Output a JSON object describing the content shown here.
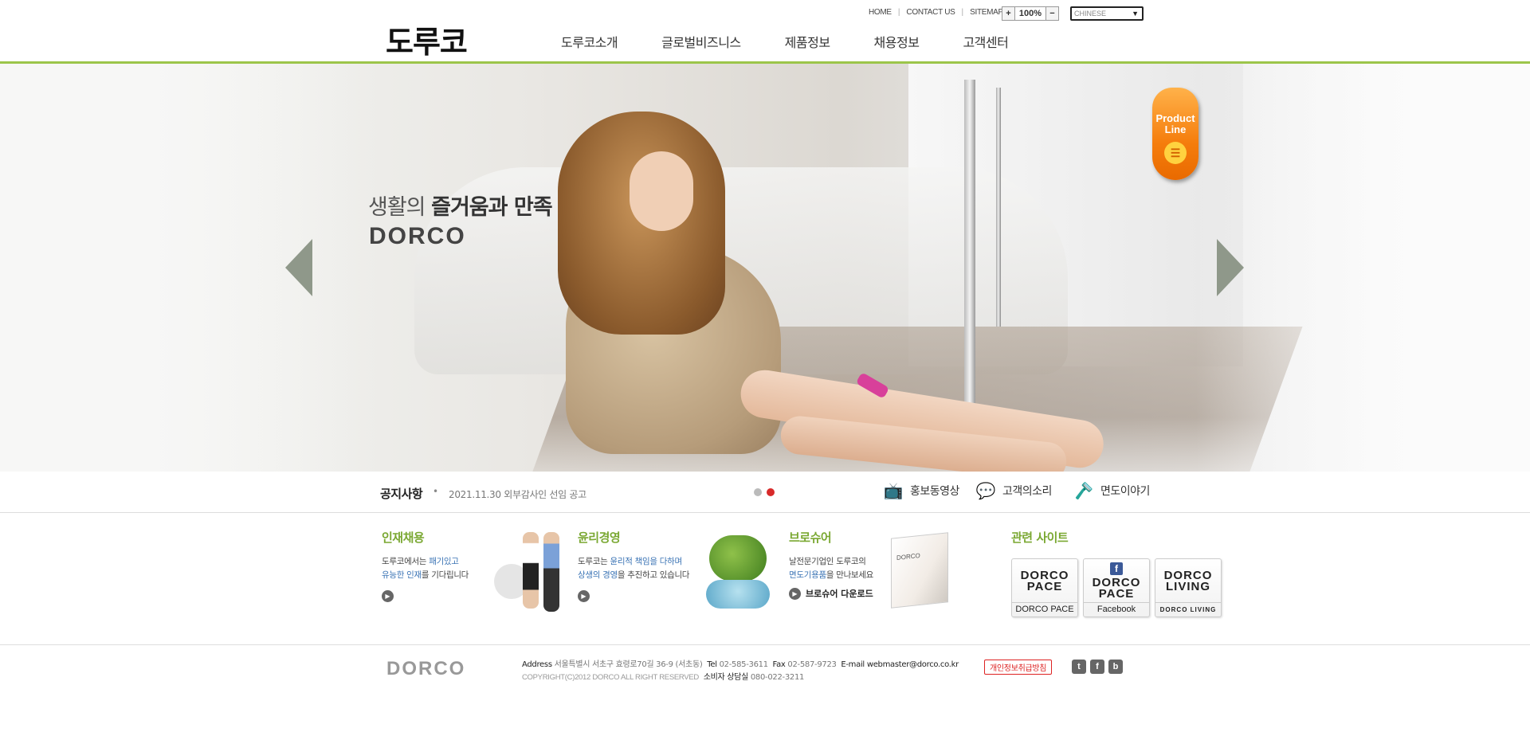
{
  "header": {
    "logo": "도루코",
    "util_links": [
      "HOME",
      "CONTACT US",
      "SITEMAP"
    ],
    "zoom": {
      "plus": "+",
      "value": "100%",
      "minus": "−"
    },
    "language": "CHINESE",
    "nav": [
      "도루코소개",
      "글로벌비즈니스",
      "제품정보",
      "채용정보",
      "고객센터"
    ]
  },
  "hero": {
    "slogan_light": "생활의 ",
    "slogan_bold": "즐거움과 만족",
    "brand": "DORCO",
    "product_line": {
      "line1": "Product",
      "line2": "Line"
    }
  },
  "notice": {
    "title": "공지사항",
    "bullet": "•",
    "text": "2021.11.30  외부감사인 선임 공고",
    "pager_active": 2,
    "quick_links": [
      "홍보동영상",
      "고객의소리",
      "면도이야기"
    ]
  },
  "sections": {
    "recruit": {
      "title": "인재채용",
      "desc1_a": "도루코에서는 ",
      "desc1_hl": "패기있고",
      "desc2_hl": "유능한 인재",
      "desc2_b": "를 기다립니다"
    },
    "ethics": {
      "title": "윤리경영",
      "desc1_a": "도루코는 ",
      "desc1_hl": "윤리적 책임을 다하며",
      "desc2_hl": "상생의 경영",
      "desc2_b": "을 추진하고 있습니다"
    },
    "brochure": {
      "title": "브로슈어",
      "desc1": "날전문기업인 도루코의",
      "desc2_hl": "면도기용품",
      "desc2_b": "을 만나보세요",
      "download": "브로슈어 다운로드",
      "thumb_label": "DORCO"
    },
    "related": {
      "title": "관련 사이트",
      "sites": [
        {
          "mark1": "DORCO",
          "mark2": "PACE",
          "label": "DORCO PACE"
        },
        {
          "mark1": "DORCO",
          "mark2": "PACE",
          "label": "Facebook"
        },
        {
          "mark1": "DORCO",
          "mark2": "LIVING",
          "label": "DORCO LIVING"
        }
      ]
    }
  },
  "footer": {
    "logo": "DORCO",
    "address_label": "Address",
    "address": "서울특별시 서초구 효령로70길 36-9 (서초동)",
    "tel_label": "Tel",
    "tel": "02-585-3611",
    "fax_label": "Fax",
    "fax": "02-587-9723",
    "email_label": "E-mail",
    "email": "webmaster@dorco.co.kr",
    "copyright": "COPYRIGHT(C)2012 DORCO ALL RIGHT RESERVED",
    "consult_label": "소비자 상담실",
    "consult": "080-022-3211",
    "privacy": "개인정보취급방침",
    "social_icons": [
      "twitter-icon",
      "facebook-icon",
      "blog-icon"
    ]
  },
  "colors": {
    "accent_green": "#9cc54a",
    "title_green": "#7aa832",
    "highlight_blue": "#3b74b5",
    "pager_red": "#d82a2a",
    "product_orange": "#f57d0c"
  }
}
